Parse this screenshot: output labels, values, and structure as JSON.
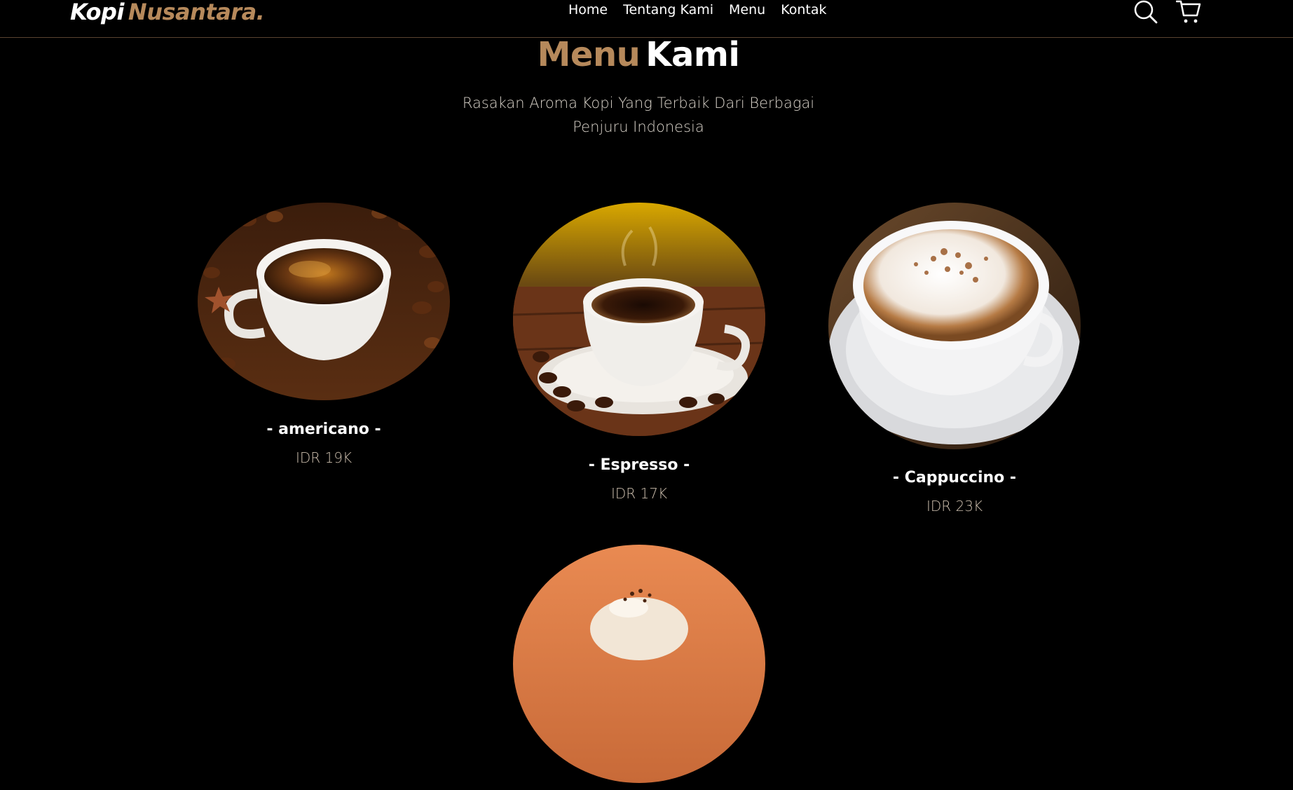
{
  "brand": {
    "part1": "Kopi",
    "part2": "Nusantara."
  },
  "nav": {
    "links": [
      "Home",
      "Tentang Kami",
      "Menu",
      "Kontak"
    ],
    "icons": [
      "search-icon",
      "cart-icon"
    ]
  },
  "menu": {
    "title_part1": "Menu",
    "title_part2": "Kami",
    "subtitle": "Rasakan Aroma Kopi Yang Terbaik Dari Berbagai Penjuru Indonesia",
    "items": [
      {
        "name": "- americano -",
        "price": "IDR 19K"
      },
      {
        "name": "- Espresso -",
        "price": "IDR 17K"
      },
      {
        "name": "- Cappuccino -",
        "price": "IDR 23K"
      },
      {
        "name": "",
        "price": ""
      }
    ]
  },
  "colors": {
    "accent": "#b6895b",
    "background": "#000000",
    "text": "#ffffff",
    "price": "#cdbfae"
  }
}
